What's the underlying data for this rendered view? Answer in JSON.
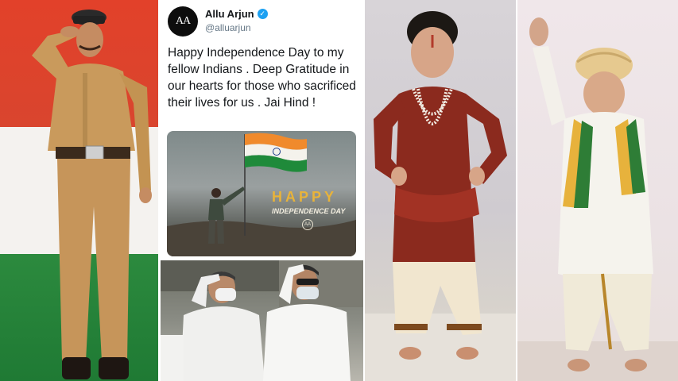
{
  "tweet": {
    "name": "Allu Arjun",
    "handle": "@alluarjun",
    "avatar_initials": "AA",
    "verified_icon": "✓",
    "text": "Happy Independence Day to my fellow Indians . Deep Gratitude in our hearts for those who sacrificed their lives for us . Jai Hind !",
    "image": {
      "headline": "HAPPY",
      "subline": "INDEPENDENCE DAY",
      "logo": "AA"
    }
  },
  "colors": {
    "saffron": "#e2412a",
    "white": "#f4f2ef",
    "green": "#2c8a3e",
    "verified_blue": "#1da1f2",
    "khaki": "#c99a5c",
    "maroon": "#8b2a1e"
  }
}
